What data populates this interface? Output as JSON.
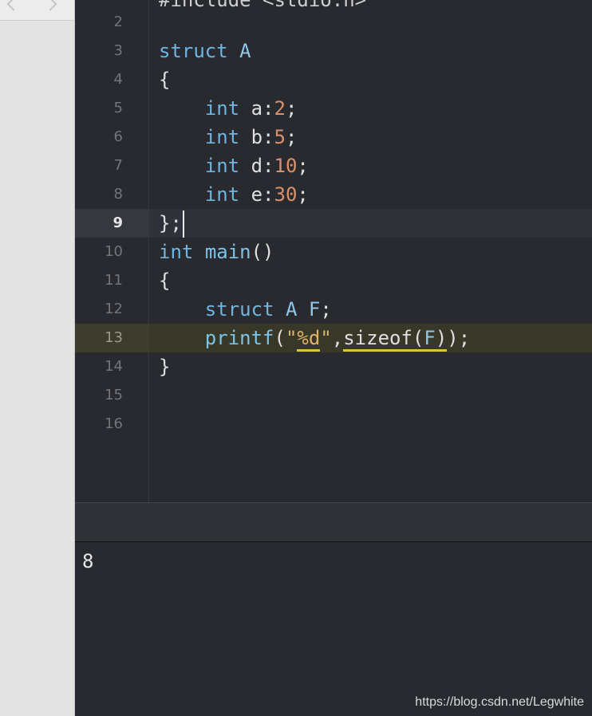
{
  "editor": {
    "top_line": "#include <stdio.h>",
    "lines": [
      {
        "num": "2",
        "segments": []
      },
      {
        "num": "3",
        "segments": [
          {
            "t": "struct",
            "c": "k"
          },
          {
            "t": " "
          },
          {
            "t": "A",
            "c": "ty"
          }
        ]
      },
      {
        "num": "4",
        "segments": [
          {
            "t": "{"
          }
        ]
      },
      {
        "num": "5",
        "segments": [
          {
            "t": "    "
          },
          {
            "t": "int",
            "c": "k"
          },
          {
            "t": " a:"
          },
          {
            "t": "2",
            "c": "num"
          },
          {
            "t": ";"
          }
        ]
      },
      {
        "num": "6",
        "segments": [
          {
            "t": "    "
          },
          {
            "t": "int",
            "c": "k"
          },
          {
            "t": " b:"
          },
          {
            "t": "5",
            "c": "num"
          },
          {
            "t": ";"
          }
        ]
      },
      {
        "num": "7",
        "segments": [
          {
            "t": "    "
          },
          {
            "t": "int",
            "c": "k"
          },
          {
            "t": " d:"
          },
          {
            "t": "10",
            "c": "num"
          },
          {
            "t": ";"
          }
        ]
      },
      {
        "num": "8",
        "segments": [
          {
            "t": "    "
          },
          {
            "t": "int",
            "c": "k"
          },
          {
            "t": " e:"
          },
          {
            "t": "30",
            "c": "num"
          },
          {
            "t": ";"
          }
        ]
      },
      {
        "num": "9",
        "segments": [
          {
            "t": "};"
          }
        ],
        "current": true
      },
      {
        "num": "10",
        "segments": [
          {
            "t": "int",
            "c": "k"
          },
          {
            "t": " "
          },
          {
            "t": "main",
            "c": "fn"
          },
          {
            "t": "()"
          }
        ]
      },
      {
        "num": "11",
        "segments": [
          {
            "t": "{"
          }
        ]
      },
      {
        "num": "12",
        "segments": [
          {
            "t": "    "
          },
          {
            "t": "struct",
            "c": "k"
          },
          {
            "t": " "
          },
          {
            "t": "A",
            "c": "ty"
          },
          {
            "t": " "
          },
          {
            "t": "F",
            "c": "ty"
          },
          {
            "t": ";"
          }
        ]
      },
      {
        "num": "13",
        "segments": [
          {
            "t": "    "
          },
          {
            "t": "printf",
            "c": "fn"
          },
          {
            "t": "("
          },
          {
            "t": "\"",
            "c": "str"
          },
          {
            "t": "%d",
            "c": "str u"
          },
          {
            "t": "\"",
            "c": "str"
          },
          {
            "t": ","
          },
          {
            "t": "sizeof(",
            "c": "u"
          },
          {
            "t": "F",
            "c": "ty u"
          },
          {
            "t": ")",
            "c": "u"
          },
          {
            "t": ");"
          }
        ],
        "warning": true
      },
      {
        "num": "14",
        "segments": [
          {
            "t": "}"
          }
        ]
      },
      {
        "num": "15",
        "segments": []
      },
      {
        "num": "16",
        "segments": []
      }
    ]
  },
  "console": {
    "output": "8"
  },
  "watermark": "https://blog.csdn.net/Legwhite",
  "colors": {
    "background": "#292a30",
    "keyword": "#6fb5e0",
    "number": "#d7926b",
    "string": "#e0b26c",
    "warning_underline": "#d6c63a"
  },
  "icons": {
    "nav_back": "chevron-left-icon",
    "nav_forward": "chevron-right-icon"
  }
}
